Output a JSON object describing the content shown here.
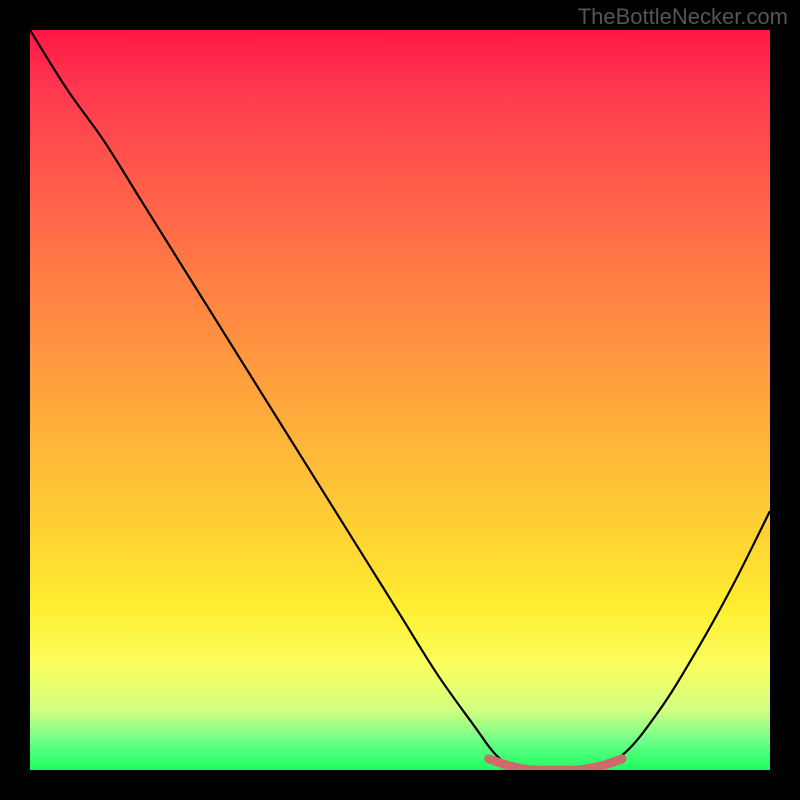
{
  "watermark": "TheBottleNecker.com",
  "chart_data": {
    "type": "line",
    "title": "",
    "xlabel": "",
    "ylabel": "",
    "xlim": [
      0,
      100
    ],
    "ylim": [
      0,
      100
    ],
    "background": {
      "gradient_type": "vertical",
      "stops": [
        {
          "pos": 0,
          "color": "#ff1744"
        },
        {
          "pos": 20,
          "color": "#ff5a4a"
        },
        {
          "pos": 44,
          "color": "#ff9740"
        },
        {
          "pos": 68,
          "color": "#ffd234"
        },
        {
          "pos": 86,
          "color": "#faff60"
        },
        {
          "pos": 100,
          "color": "#1aff5f"
        }
      ]
    },
    "series": [
      {
        "name": "bottleneck-curve",
        "color": "#000000",
        "x": [
          0,
          5,
          10,
          15,
          20,
          25,
          30,
          35,
          40,
          45,
          50,
          55,
          60,
          63,
          66,
          70,
          75,
          80,
          85,
          90,
          95,
          100
        ],
        "y": [
          100,
          92,
          85,
          77,
          69,
          61,
          53,
          45,
          37,
          29,
          21,
          13,
          6,
          2,
          0,
          0,
          0,
          2,
          8,
          16,
          25,
          35
        ]
      },
      {
        "name": "optimal-range-marker",
        "color": "#d07070",
        "style": "thick",
        "x": [
          62,
          65,
          68,
          71,
          74,
          77,
          80
        ],
        "y": [
          1.5,
          0.5,
          0,
          0,
          0,
          0.5,
          1.5
        ]
      }
    ],
    "annotations": []
  }
}
